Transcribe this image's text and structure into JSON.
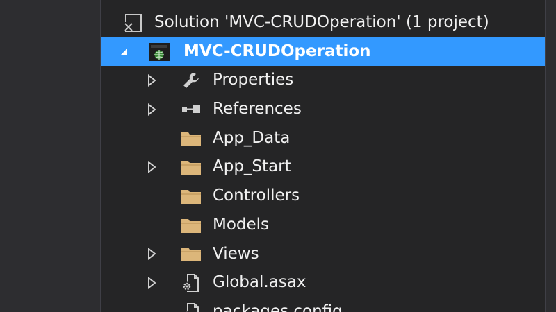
{
  "solution_explorer": {
    "solution": {
      "label": "Solution 'MVC-CRUDOperation' (1 project)",
      "icon": "solution-icon"
    },
    "project": {
      "label": "MVC-CRUDOperation",
      "icon": "web-project-icon",
      "expanded": true,
      "selected": true
    },
    "items": [
      {
        "label": "Properties",
        "icon": "wrench-icon",
        "expandable": true
      },
      {
        "label": "References",
        "icon": "references-icon",
        "expandable": true
      },
      {
        "label": "App_Data",
        "icon": "folder-icon",
        "expandable": false
      },
      {
        "label": "App_Start",
        "icon": "folder-icon",
        "expandable": true
      },
      {
        "label": "Controllers",
        "icon": "folder-icon",
        "expandable": false
      },
      {
        "label": "Models",
        "icon": "folder-icon",
        "expandable": false
      },
      {
        "label": "Views",
        "icon": "folder-icon",
        "expandable": true
      },
      {
        "label": "Global.asax",
        "icon": "config-file-icon",
        "expandable": true
      },
      {
        "label": "packages.config",
        "icon": "config-file-icon",
        "expandable": false
      }
    ]
  },
  "colors": {
    "background": "#252526",
    "selection": "#3399ff",
    "text": "#f1f1f1",
    "folder": "#dcb67a"
  }
}
